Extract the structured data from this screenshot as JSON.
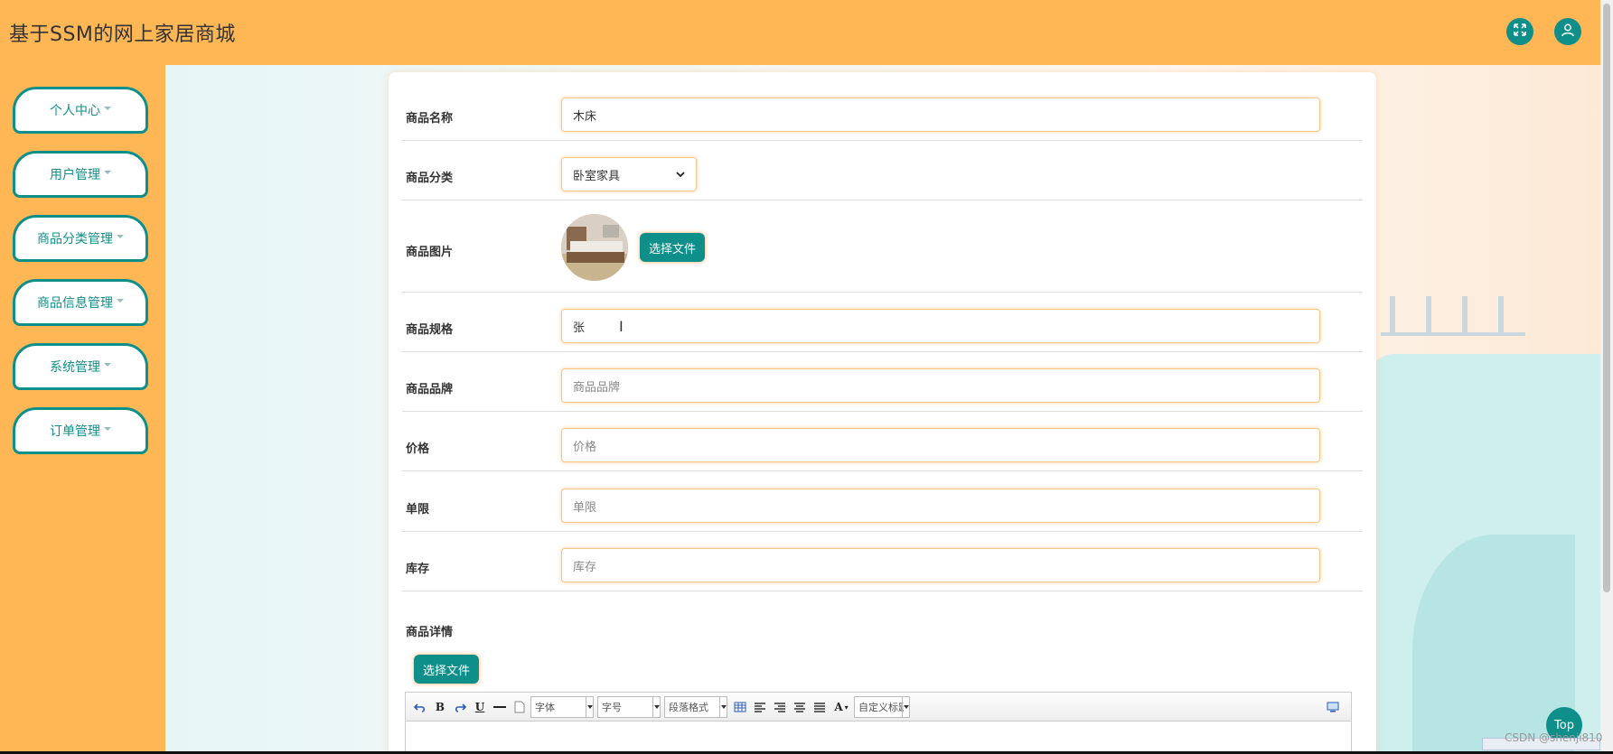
{
  "app": {
    "title": "基于SSM的网上家居商城"
  },
  "header": {
    "fullscreen_icon": "expand-icon",
    "user_icon": "user-icon"
  },
  "sidebar": {
    "items": [
      {
        "label": "个人中心"
      },
      {
        "label": "用户管理"
      },
      {
        "label": "商品分类管理"
      },
      {
        "label": "商品信息管理"
      },
      {
        "label": "系统管理"
      },
      {
        "label": "订单管理"
      }
    ]
  },
  "form": {
    "name": {
      "label": "商品名称",
      "value": "木床"
    },
    "category": {
      "label": "商品分类",
      "value": "卧室家具"
    },
    "image": {
      "label": "商品图片",
      "button": "选择文件"
    },
    "spec": {
      "label": "商品规格",
      "value": "张"
    },
    "brand": {
      "label": "商品品牌",
      "placeholder": "商品品牌"
    },
    "price": {
      "label": "价格",
      "placeholder": "价格"
    },
    "limit": {
      "label": "单限",
      "placeholder": "单限"
    },
    "stock": {
      "label": "库存",
      "placeholder": "库存"
    },
    "detail": {
      "label": "商品详情",
      "button": "选择文件"
    }
  },
  "editor": {
    "font_family": "字体",
    "font_size": "字号",
    "paragraph": "段落格式",
    "custom_title": "自定义标题"
  },
  "top_button": "Top",
  "watermark": "CSDN @shenji810",
  "colors": {
    "header_bg": "#ffb655",
    "accent": "#0f8f8a"
  }
}
